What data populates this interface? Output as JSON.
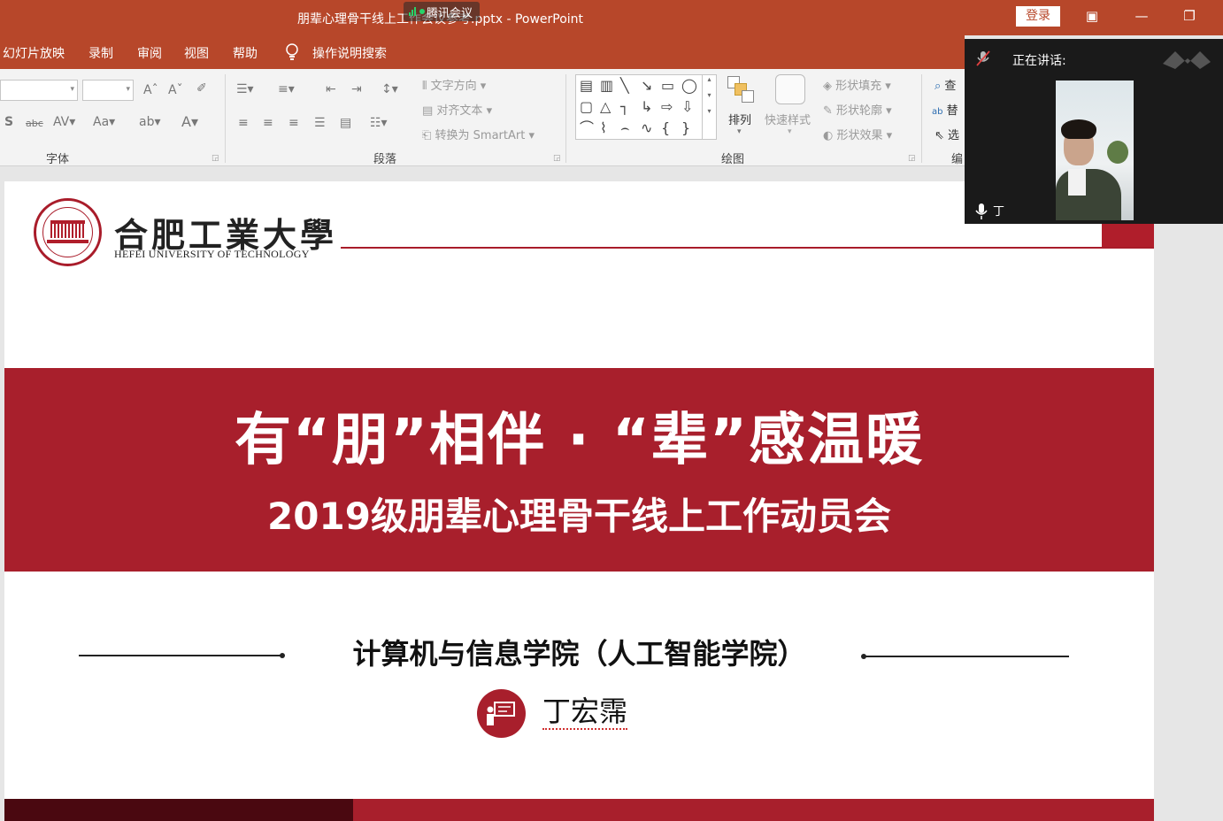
{
  "titlebar": {
    "document_title": "朋辈心理骨干线上工作会议参考.pptx  -  PowerPoint",
    "meeting_app": "腾讯会议",
    "login_label": "登录"
  },
  "menu": {
    "items": [
      "幻灯片放映",
      "录制",
      "审阅",
      "视图",
      "帮助"
    ],
    "search": "操作说明搜索"
  },
  "ribbon": {
    "groups": {
      "font": "字体",
      "paragraph": "段落",
      "drawing": "绘图",
      "editing": "编"
    },
    "paragraph": {
      "text_direction": "文字方向",
      "align_text": "对齐文本",
      "convert_smartart": "转换为 SmartArt"
    },
    "drawing": {
      "arrange": "排列",
      "quick_styles": "快速样式",
      "shape_fill": "形状填充",
      "shape_outline": "形状轮廓",
      "shape_effects": "形状效果"
    },
    "editing": {
      "find": "查",
      "replace": "替",
      "select": "选"
    }
  },
  "slide": {
    "logo_cn": "合肥工業大學",
    "logo_en": "HEFEI UNIVERSITY OF TECHNOLOGY",
    "headline": "有“朋”相伴 · “辈”感温暖",
    "subheadline": "2019级朋辈心理骨干线上工作动员会",
    "department": "计算机与信息学院（人工智能学院）",
    "presenter": "丁宏霈"
  },
  "meeting": {
    "speaking_label": "正在讲话:",
    "participant_name": "丁"
  },
  "colors": {
    "titlebar": "#b7472a",
    "slide_red": "#a81f2c",
    "slide_dark": "#4a0810"
  }
}
